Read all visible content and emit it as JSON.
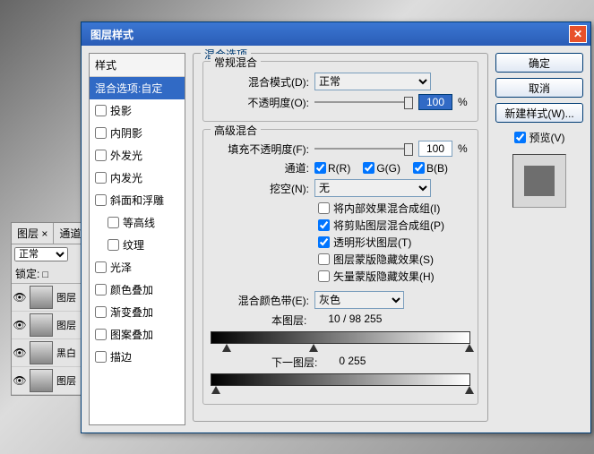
{
  "dialog": {
    "title": "图层样式",
    "styles_header": "样式",
    "items": [
      {
        "label": "混合选项:自定",
        "selected": true,
        "checkbox": false
      },
      {
        "label": "投影",
        "checkbox": true,
        "checked": false
      },
      {
        "label": "内阴影",
        "checkbox": true,
        "checked": false
      },
      {
        "label": "外发光",
        "checkbox": true,
        "checked": false
      },
      {
        "label": "内发光",
        "checkbox": true,
        "checked": false
      },
      {
        "label": "斜面和浮雕",
        "checkbox": true,
        "checked": false
      },
      {
        "label": "等高线",
        "checkbox": true,
        "checked": false,
        "sub": true
      },
      {
        "label": "纹理",
        "checkbox": true,
        "checked": false,
        "sub": true
      },
      {
        "label": "光泽",
        "checkbox": true,
        "checked": false
      },
      {
        "label": "颜色叠加",
        "checkbox": true,
        "checked": false
      },
      {
        "label": "渐变叠加",
        "checkbox": true,
        "checked": false
      },
      {
        "label": "图案叠加",
        "checkbox": true,
        "checked": false
      },
      {
        "label": "描边",
        "checkbox": true,
        "checked": false
      }
    ],
    "blend_options_title": "混合选项",
    "general_title": "常规混合",
    "blend_mode_label": "混合模式(D):",
    "blend_mode_value": "正常",
    "opacity_label": "不透明度(O):",
    "opacity_value": "100",
    "advanced_title": "高级混合",
    "fill_opacity_label": "填充不透明度(F):",
    "fill_opacity_value": "100",
    "channels_label": "通道:",
    "ch_r": "R(R)",
    "ch_g": "G(G)",
    "ch_b": "B(B)",
    "knockout_label": "挖空(N):",
    "knockout_value": "无",
    "adv_checks": [
      {
        "label": "将内部效果混合成组(I)",
        "checked": false
      },
      {
        "label": "将剪贴图层混合成组(P)",
        "checked": true
      },
      {
        "label": "透明形状图层(T)",
        "checked": true
      },
      {
        "label": "图层蒙版隐藏效果(S)",
        "checked": false
      },
      {
        "label": "矢量蒙版隐藏效果(H)",
        "checked": false
      }
    ],
    "blend_if_label": "混合颜色带(E):",
    "blend_if_value": "灰色",
    "this_layer_label": "本图层:",
    "this_layer_vals": "10  /  98       255",
    "under_layer_label": "下一图层:",
    "under_layer_vals": "0                 255",
    "percent": "%"
  },
  "buttons": {
    "ok": "确定",
    "cancel": "取消",
    "new_style": "新建样式(W)...",
    "preview": "预览(V)"
  },
  "layers_panel": {
    "tab1": "图层 ×",
    "tab2": "通道",
    "blend": "正常",
    "lock_label": "锁定:",
    "rows": [
      {
        "name": "图层"
      },
      {
        "name": "图层"
      },
      {
        "name": "黑白"
      },
      {
        "name": "图层"
      }
    ]
  }
}
